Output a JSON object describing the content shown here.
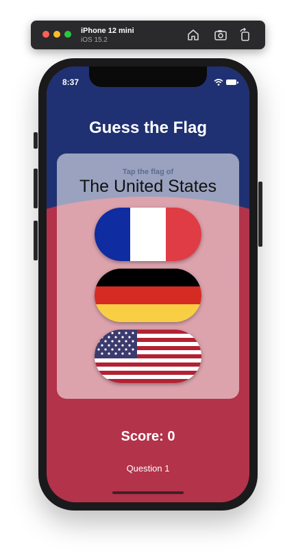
{
  "simulator": {
    "device_name": "iPhone 12 mini",
    "os_version": "iOS 15.2",
    "icons": [
      "home-icon",
      "screenshot-icon",
      "rotate-icon"
    ]
  },
  "status_bar": {
    "time": "8:37",
    "icons": [
      "wifi-icon",
      "battery-icon"
    ]
  },
  "app": {
    "title": "Guess the Flag",
    "prompt_label": "Tap the flag of",
    "prompt_country": "The United States",
    "flags": [
      {
        "country": "France",
        "icon": "france-flag-icon"
      },
      {
        "country": "Germany",
        "icon": "germany-flag-icon"
      },
      {
        "country": "The United States",
        "icon": "us-flag-icon"
      }
    ],
    "score_label": "Score: 0",
    "question_label": "Question 1"
  },
  "colors": {
    "top_background": "#1f3172",
    "bottom_background": "#b2334a",
    "card": "rgba(255,255,255,0.55)",
    "text_light": "#ffffff"
  }
}
